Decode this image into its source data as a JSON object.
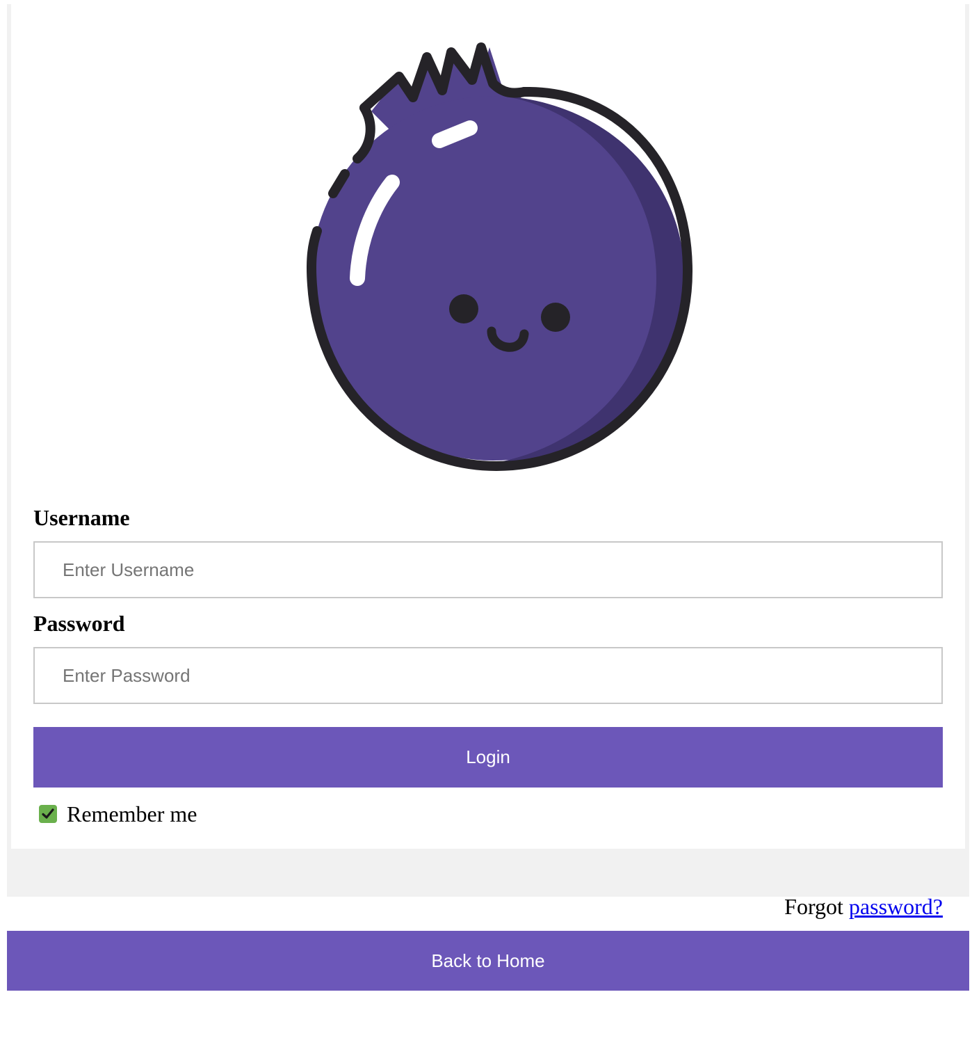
{
  "logo": {
    "icon": "blueberry-mascot-icon",
    "colors": {
      "body": "#52438c",
      "shade": "#3f336f",
      "outline": "#252328",
      "highlight": "#ffffff"
    }
  },
  "form": {
    "username_label": "Username",
    "username_placeholder": "Enter Username",
    "password_label": "Password",
    "password_placeholder": "Enter Password",
    "login_label": "Login",
    "remember_label": "Remember me",
    "remember_checked": true
  },
  "footer": {
    "forgot_text": "Forgot",
    "forgot_link": "password?",
    "home_label": "Back to Home"
  },
  "colors": {
    "accent": "#6c57b9",
    "checkbox": "#6ab04c",
    "panel_bg": "#f1f1f1",
    "link": "#0000ee"
  }
}
